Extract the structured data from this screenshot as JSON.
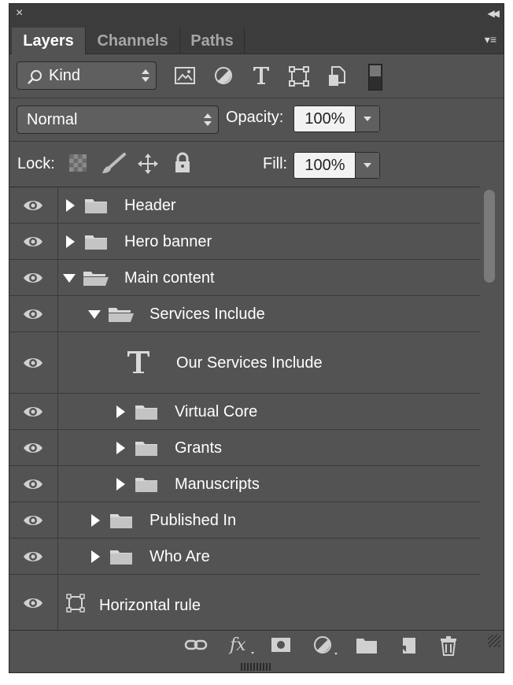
{
  "window": {
    "close_glyph": "×",
    "collapse_glyph": "◀◀",
    "menu_glyph": "▾≡"
  },
  "tabs": [
    {
      "label": "Layers",
      "active": true
    },
    {
      "label": "Channels",
      "active": false
    },
    {
      "label": "Paths",
      "active": false
    }
  ],
  "filter": {
    "kind_label": "Kind",
    "icons": [
      "pixel-layer-filter-icon",
      "adjustment-layer-filter-icon",
      "type-layer-filter-icon",
      "shape-layer-filter-icon",
      "smart-object-filter-icon",
      "filter-toggle-icon"
    ]
  },
  "blend": {
    "mode": "Normal",
    "opacity_label": "Opacity:",
    "opacity_value": "100%"
  },
  "lock": {
    "label": "Lock:",
    "fill_label": "Fill:",
    "fill_value": "100%"
  },
  "layers": [
    {
      "name": "Header",
      "type": "group",
      "expanded": false,
      "indent": 0
    },
    {
      "name": "Hero banner",
      "type": "group",
      "expanded": false,
      "indent": 0
    },
    {
      "name": "Main content",
      "type": "group",
      "expanded": true,
      "indent": 0
    },
    {
      "name": "Services Include",
      "type": "group",
      "expanded": true,
      "indent": 1
    },
    {
      "name": "Our Services Include",
      "type": "text",
      "indent": 2
    },
    {
      "name": "Virtual Core",
      "type": "group",
      "expanded": false,
      "indent": 2
    },
    {
      "name": "Grants",
      "type": "group",
      "expanded": false,
      "indent": 2
    },
    {
      "name": "Manuscripts",
      "type": "group",
      "expanded": false,
      "indent": 2
    },
    {
      "name": "Published In",
      "type": "group",
      "expanded": false,
      "indent": 1
    },
    {
      "name": "Who Are",
      "type": "group",
      "expanded": false,
      "indent": 1
    },
    {
      "name": "Horizontal rule",
      "type": "shape",
      "indent": 0
    }
  ],
  "bottom_icons": [
    "link-layers-icon",
    "fx-icon",
    "layer-mask-icon",
    "adjustment-layer-icon",
    "new-group-icon",
    "new-layer-icon",
    "trash-icon"
  ],
  "colors": {
    "panel_bg": "#535353",
    "header_bg": "#3c3c3c",
    "text": "#ffffff"
  }
}
